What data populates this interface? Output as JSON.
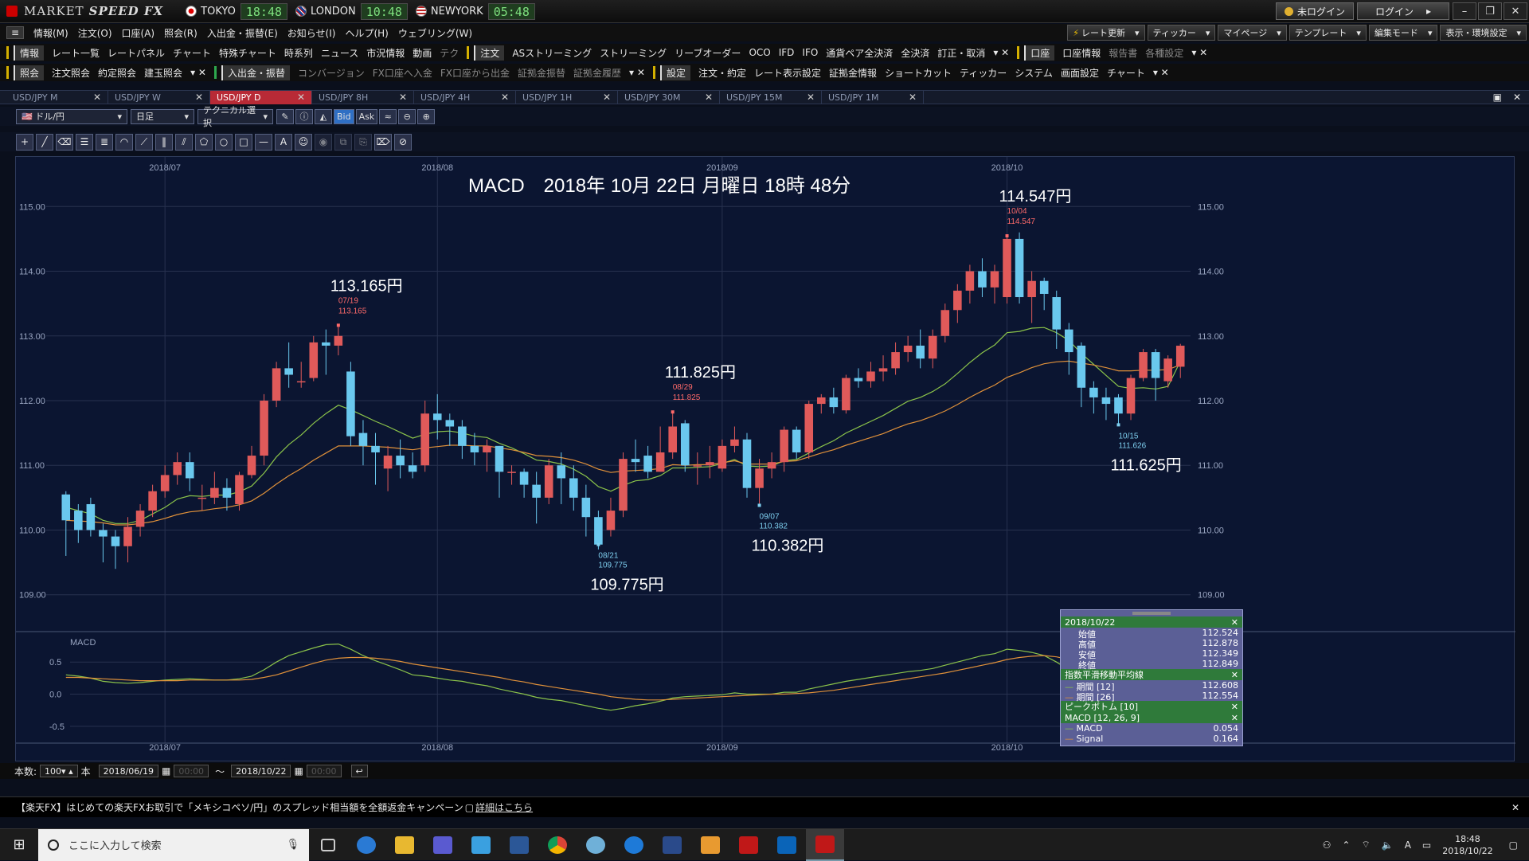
{
  "app": {
    "name_a": "MARKET",
    "name_b": "SPEED FX"
  },
  "clocks": [
    {
      "city": "TOKYO",
      "time": "18:48"
    },
    {
      "city": "LONDON",
      "time": "10:48"
    },
    {
      "city": "NEWYORK",
      "time": "05:48"
    }
  ],
  "login": {
    "status": "未ログイン",
    "button": "ログイン"
  },
  "menu": [
    "情報(M)",
    "注文(O)",
    "口座(A)",
    "照会(R)",
    "入出金・振替(E)",
    "お知らせ(I)",
    "ヘルプ(H)",
    "ウェブリング(W)"
  ],
  "menu_right": [
    "レート更新",
    "ティッカー",
    "マイページ",
    "テンプレート",
    "編集モード",
    "表示・環境設定"
  ],
  "toolbar1": [
    "情報",
    "レート一覧",
    "レートパネル",
    "チャート",
    "特殊チャート",
    "時系列",
    "ニュース",
    "市況情報",
    "動画",
    "テク"
  ],
  "toolbar1b": [
    "注文",
    "ASストリーミング",
    "ストリーミング",
    "リーブオーダー",
    "OCO",
    "IFD",
    "IFO",
    "通貨ペア全決済",
    "全決済",
    "訂正・取消"
  ],
  "toolbar1c": [
    "口座",
    "口座情報",
    "報告書",
    "各種設定"
  ],
  "toolbar2": [
    "照会",
    "注文照会",
    "約定照会",
    "建玉照会"
  ],
  "toolbar2b": [
    "入出金・振替",
    "コンバージョン",
    "FX口座へ入金",
    "FX口座から出金",
    "証拠金振替",
    "証拠金履歴"
  ],
  "toolbar2c": [
    "設定",
    "注文・約定",
    "レート表示設定",
    "証拠金情報",
    "ショートカット",
    "ティッカー",
    "システム",
    "画面設定",
    "チャート"
  ],
  "tabs": [
    "USD/JPY M",
    "USD/JPY W",
    "USD/JPY D",
    "USD/JPY 8H",
    "USD/JPY 4H",
    "USD/JPY 1H",
    "USD/JPY 30M",
    "USD/JPY 15M",
    "USD/JPY 1M"
  ],
  "active_tab": 2,
  "controls": {
    "pair": "ドル/円",
    "period": "日足",
    "tech": "テクニカル選択",
    "bid": "Bid",
    "ask": "Ask"
  },
  "chart_title": "MACD　2018年 10月 22日 月曜日 18時 48分",
  "chart_data": {
    "type": "candlestick",
    "x_labels": [
      "2018/07",
      "2018/08",
      "2018/09",
      "2018/10"
    ],
    "y_ticks": [
      "115.00",
      "114.00",
      "113.00",
      "112.00",
      "111.00",
      "110.00",
      "109.00"
    ],
    "macd_label": "MACD",
    "macd_ticks": [
      "0.5",
      "0.0",
      "-0.5"
    ],
    "peaks": [
      {
        "date": "07/19",
        "value": "113.165",
        "big": "113.165円",
        "type": "high"
      },
      {
        "date": "08/21",
        "value": "109.775",
        "big": "109.775円",
        "type": "low"
      },
      {
        "date": "08/29",
        "value": "111.825",
        "big": "111.825円",
        "type": "high"
      },
      {
        "date": "09/07",
        "value": "110.382",
        "big": "110.382円",
        "type": "low"
      },
      {
        "date": "10/04",
        "value": "114.547",
        "big": "114.547円",
        "type": "high"
      },
      {
        "date": "10/15",
        "value": "111.626",
        "big": "111.625円",
        "type": "low"
      }
    ],
    "candles": [
      [
        110.55,
        110.15,
        110.6,
        109.6
      ],
      [
        110.3,
        110.0,
        110.4,
        109.8
      ],
      [
        110.4,
        110.0,
        110.5,
        109.9
      ],
      [
        110.0,
        109.9,
        110.1,
        109.5
      ],
      [
        109.9,
        109.75,
        110.0,
        109.4
      ],
      [
        109.75,
        110.05,
        110.2,
        109.5
      ],
      [
        110.05,
        110.3,
        110.4,
        109.9
      ],
      [
        110.3,
        110.6,
        110.7,
        110.2
      ],
      [
        110.6,
        110.85,
        111.0,
        110.5
      ],
      [
        110.85,
        111.05,
        111.2,
        110.7
      ],
      [
        111.05,
        110.8,
        111.2,
        110.6
      ],
      [
        110.5,
        110.5,
        110.7,
        110.3
      ],
      [
        110.5,
        110.65,
        110.9,
        110.4
      ],
      [
        110.65,
        110.5,
        110.8,
        110.3
      ],
      [
        110.4,
        110.85,
        110.9,
        110.3
      ],
      [
        110.85,
        111.15,
        111.3,
        110.8
      ],
      [
        111.15,
        112.0,
        112.1,
        111.0
      ],
      [
        112.0,
        112.5,
        112.6,
        111.9
      ],
      [
        112.5,
        112.4,
        112.9,
        112.2
      ],
      [
        112.3,
        112.3,
        112.6,
        112.2
      ],
      [
        112.35,
        112.9,
        113.0,
        112.3
      ],
      [
        112.9,
        112.85,
        113.1,
        112.4
      ],
      [
        112.85,
        113.0,
        113.165,
        112.7
      ],
      [
        112.45,
        111.45,
        112.6,
        111.3
      ],
      [
        111.5,
        111.3,
        111.7,
        111.0
      ],
      [
        111.3,
        111.2,
        111.5,
        110.7
      ],
      [
        110.95,
        111.15,
        111.3,
        110.6
      ],
      [
        111.15,
        111.0,
        111.4,
        110.8
      ],
      [
        111.0,
        110.9,
        111.2,
        110.8
      ],
      [
        111.0,
        111.8,
        112.0,
        110.9
      ],
      [
        111.8,
        111.7,
        112.1,
        111.4
      ],
      [
        111.7,
        111.6,
        111.8,
        111.3
      ],
      [
        111.6,
        111.3,
        111.7,
        111.1
      ],
      [
        111.3,
        111.2,
        111.5,
        111.0
      ],
      [
        111.2,
        111.3,
        111.4,
        110.9
      ],
      [
        111.3,
        110.9,
        111.3,
        110.5
      ],
      [
        110.9,
        110.9,
        111.0,
        110.7
      ],
      [
        110.9,
        110.7,
        110.95,
        110.5
      ],
      [
        110.7,
        110.5,
        110.9,
        110.1
      ],
      [
        110.5,
        111.0,
        111.1,
        110.4
      ],
      [
        111.0,
        110.8,
        111.2,
        110.4
      ],
      [
        110.8,
        110.5,
        111.0,
        110.3
      ],
      [
        110.5,
        110.2,
        110.7,
        109.9
      ],
      [
        110.2,
        109.775,
        110.3,
        109.7
      ],
      [
        110.0,
        110.3,
        110.5,
        109.9
      ],
      [
        110.3,
        111.1,
        111.2,
        110.2
      ],
      [
        111.1,
        111.05,
        111.4,
        110.9
      ],
      [
        111.15,
        110.9,
        111.3,
        110.8
      ],
      [
        110.9,
        111.2,
        111.6,
        110.9
      ],
      [
        111.2,
        111.6,
        111.825,
        111.1
      ],
      [
        111.65,
        111.0,
        111.7,
        110.9
      ],
      [
        111.0,
        111.0,
        111.2,
        110.7
      ],
      [
        111.0,
        111.05,
        111.3,
        110.8
      ],
      [
        110.95,
        111.3,
        111.4,
        110.9
      ],
      [
        111.3,
        111.4,
        111.6,
        111.2
      ],
      [
        111.4,
        110.65,
        111.5,
        110.5
      ],
      [
        110.65,
        110.95,
        111.1,
        110.382
      ],
      [
        110.95,
        111.05,
        111.2,
        110.8
      ],
      [
        111.05,
        111.55,
        111.6,
        110.9
      ],
      [
        111.55,
        111.2,
        111.6,
        111.1
      ],
      [
        111.2,
        111.95,
        112.0,
        111.1
      ],
      [
        111.95,
        112.05,
        112.1,
        111.8
      ],
      [
        112.05,
        111.9,
        112.2,
        111.8
      ],
      [
        111.85,
        112.35,
        112.4,
        111.8
      ],
      [
        112.35,
        112.3,
        112.5,
        112.2
      ],
      [
        112.3,
        112.45,
        112.6,
        112.2
      ],
      [
        112.45,
        112.5,
        112.7,
        112.3
      ],
      [
        112.5,
        112.75,
        112.9,
        112.4
      ],
      [
        112.75,
        112.85,
        113.0,
        112.6
      ],
      [
        112.85,
        112.65,
        113.1,
        112.5
      ],
      [
        112.65,
        113.0,
        113.1,
        112.5
      ],
      [
        113.0,
        113.4,
        113.5,
        112.9
      ],
      [
        113.4,
        113.7,
        113.8,
        113.2
      ],
      [
        113.7,
        114.0,
        114.1,
        113.5
      ],
      [
        114.0,
        113.75,
        114.2,
        113.6
      ],
      [
        113.75,
        114.0,
        114.1,
        113.5
      ],
      [
        113.6,
        114.5,
        114.547,
        113.5
      ],
      [
        114.5,
        113.6,
        114.6,
        113.5
      ],
      [
        113.6,
        113.85,
        114.0,
        113.2
      ],
      [
        113.85,
        113.65,
        113.9,
        113.4
      ],
      [
        113.6,
        113.1,
        113.7,
        112.8
      ],
      [
        113.1,
        112.75,
        113.2,
        112.4
      ],
      [
        112.85,
        112.2,
        112.9,
        111.9
      ],
      [
        112.2,
        112.05,
        112.3,
        111.8
      ],
      [
        112.05,
        111.95,
        112.2,
        111.7
      ],
      [
        112.05,
        111.8,
        112.1,
        111.626
      ],
      [
        111.8,
        112.35,
        112.4,
        111.7
      ],
      [
        112.35,
        112.75,
        112.8,
        112.3
      ],
      [
        112.75,
        112.35,
        112.8,
        112.0
      ],
      [
        112.3,
        112.65,
        112.7,
        112.2
      ],
      [
        112.524,
        112.849,
        112.878,
        112.349
      ]
    ],
    "ema12": [
      110.35,
      110.3,
      110.25,
      110.15,
      110.1,
      110.1,
      110.15,
      110.25,
      110.35,
      110.48,
      110.53,
      110.52,
      110.54,
      110.54,
      110.59,
      110.68,
      110.88,
      111.13,
      111.32,
      111.47,
      111.65,
      111.8,
      111.93,
      111.86,
      111.77,
      111.68,
      111.6,
      111.51,
      111.42,
      111.48,
      111.52,
      111.53,
      111.5,
      111.45,
      111.43,
      111.34,
      111.27,
      111.18,
      111.08,
      111.06,
      111.02,
      110.94,
      110.83,
      110.67,
      110.6,
      110.69,
      110.76,
      110.78,
      110.84,
      110.96,
      110.96,
      110.97,
      110.98,
      111.03,
      111.09,
      110.99,
      110.98,
      110.99,
      111.07,
      111.09,
      111.19,
      111.29,
      111.38,
      111.5,
      111.59,
      111.68,
      111.77,
      111.88,
      111.99,
      112.05,
      112.14,
      112.26,
      112.42,
      112.59,
      112.74,
      112.86,
      113.05,
      113.07,
      113.12,
      113.13,
      113.05,
      112.93,
      112.73,
      112.56,
      112.39,
      112.22,
      112.19,
      112.2,
      112.18,
      112.22,
      112.608
    ],
    "ema26": [
      110.15,
      110.14,
      110.13,
      110.11,
      110.08,
      110.08,
      110.1,
      110.13,
      110.18,
      110.24,
      110.28,
      110.3,
      110.33,
      110.35,
      110.39,
      110.45,
      110.57,
      110.71,
      110.84,
      110.95,
      111.08,
      111.19,
      111.3,
      111.3,
      111.3,
      111.29,
      111.28,
      111.26,
      111.24,
      111.27,
      111.29,
      111.31,
      111.31,
      111.3,
      111.3,
      111.27,
      111.24,
      111.2,
      111.15,
      111.14,
      111.12,
      111.08,
      111.02,
      110.94,
      110.89,
      110.91,
      110.92,
      110.93,
      110.95,
      111.01,
      111.0,
      111.01,
      111.01,
      111.04,
      111.07,
      111.02,
      111.02,
      111.02,
      111.06,
      111.07,
      111.13,
      111.19,
      111.24,
      111.31,
      111.37,
      111.43,
      111.49,
      111.57,
      111.64,
      111.69,
      111.76,
      111.84,
      111.94,
      112.05,
      112.15,
      112.24,
      112.36,
      112.43,
      112.51,
      112.57,
      112.6,
      112.61,
      112.58,
      112.55,
      112.51,
      112.46,
      112.46,
      112.47,
      112.47,
      112.48,
      112.554
    ],
    "macd": [
      0.3,
      0.28,
      0.25,
      0.2,
      0.18,
      0.17,
      0.18,
      0.2,
      0.22,
      0.23,
      0.24,
      0.23,
      0.22,
      0.22,
      0.24,
      0.28,
      0.38,
      0.5,
      0.6,
      0.66,
      0.72,
      0.77,
      0.78,
      0.7,
      0.6,
      0.52,
      0.45,
      0.38,
      0.3,
      0.28,
      0.25,
      0.22,
      0.2,
      0.16,
      0.13,
      0.08,
      0.04,
      0.0,
      -0.05,
      -0.08,
      -0.1,
      -0.14,
      -0.18,
      -0.22,
      -0.25,
      -0.22,
      -0.18,
      -0.15,
      -0.11,
      -0.06,
      -0.04,
      -0.03,
      -0.02,
      -0.01,
      0.02,
      0.0,
      0.0,
      0.0,
      0.03,
      0.03,
      0.08,
      0.12,
      0.16,
      0.2,
      0.23,
      0.26,
      0.29,
      0.32,
      0.35,
      0.37,
      0.4,
      0.45,
      0.5,
      0.55,
      0.6,
      0.63,
      0.7,
      0.68,
      0.65,
      0.6,
      0.5,
      0.38,
      0.25,
      0.15,
      0.08,
      0.05,
      0.05,
      0.03,
      0.02,
      0.03,
      0.054
    ],
    "signal": [
      0.26,
      0.26,
      0.25,
      0.24,
      0.23,
      0.22,
      0.21,
      0.21,
      0.21,
      0.21,
      0.22,
      0.22,
      0.22,
      0.22,
      0.22,
      0.23,
      0.26,
      0.3,
      0.36,
      0.42,
      0.48,
      0.53,
      0.56,
      0.57,
      0.57,
      0.56,
      0.54,
      0.51,
      0.47,
      0.44,
      0.41,
      0.38,
      0.35,
      0.32,
      0.29,
      0.26,
      0.22,
      0.19,
      0.15,
      0.12,
      0.09,
      0.06,
      0.03,
      0.0,
      -0.04,
      -0.06,
      -0.08,
      -0.09,
      -0.09,
      -0.08,
      -0.07,
      -0.06,
      -0.05,
      -0.04,
      -0.03,
      -0.02,
      -0.01,
      0.0,
      0.0,
      0.01,
      0.02,
      0.04,
      0.06,
      0.09,
      0.12,
      0.15,
      0.18,
      0.21,
      0.24,
      0.27,
      0.3,
      0.33,
      0.37,
      0.41,
      0.45,
      0.49,
      0.54,
      0.57,
      0.59,
      0.6,
      0.58,
      0.54,
      0.48,
      0.42,
      0.36,
      0.31,
      0.27,
      0.24,
      0.21,
      0.18,
      0.164
    ]
  },
  "infobox": {
    "date": "2018/10/22",
    "ohlc": [
      [
        "始値",
        "112.524"
      ],
      [
        "高値",
        "112.878"
      ],
      [
        "安値",
        "112.349"
      ],
      [
        "終値",
        "112.849"
      ]
    ],
    "ema_title": "指数平滑移動平均線",
    "ema": [
      [
        "期間 [12]",
        "112.608"
      ],
      [
        "期間 [26]",
        "112.554"
      ]
    ],
    "peak_title": "ピークボトム [10]",
    "macd_title": "MACD [12, 26, 9]",
    "macd": [
      [
        "MACD",
        "0.054"
      ],
      [
        "Signal",
        "0.164"
      ]
    ]
  },
  "bottom": {
    "count_label": "本数:",
    "count": "100",
    "unit": "本",
    "from": "2018/06/19",
    "to": "2018/10/22",
    "time_ph": "00:00",
    "tilde": "～"
  },
  "banner": {
    "text": "【楽天FX】はじめての楽天FXお取引で「メキシコペソ/円」のスプレッド相当額を全額返金キャンペーン",
    "link": "詳細はこちら"
  },
  "taskbar": {
    "search": "ここに入力して検索",
    "time": "18:48",
    "date": "2018/10/22",
    "ime": "A"
  },
  "colors": {
    "up": "#e05a5a",
    "down": "#6ac8ee",
    "ema12": "#8bc34a",
    "ema26": "#e0913a",
    "grid": "#27314f",
    "bg": "#0b1531"
  }
}
